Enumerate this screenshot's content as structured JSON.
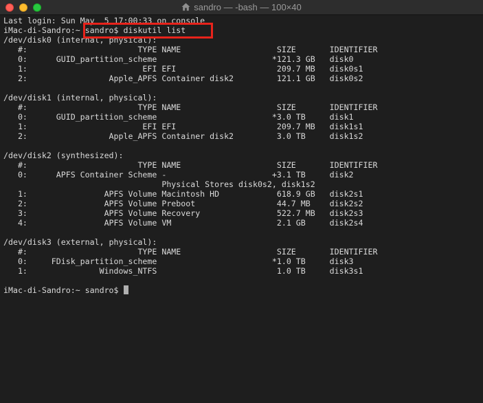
{
  "window": {
    "title": "sandro — -bash — 100×40"
  },
  "terminal": {
    "lines": [
      "Last login: Sun May  5 17:00:33 on console",
      "iMac-di-Sandro:~ sandro$ diskutil list",
      "/dev/disk0 (internal, physical):",
      "   #:                       TYPE NAME                    SIZE       IDENTIFIER",
      "   0:      GUID_partition_scheme                        *121.3 GB   disk0",
      "   1:                        EFI EFI                     209.7 MB   disk0s1",
      "   2:                 Apple_APFS Container disk2         121.1 GB   disk0s2",
      "",
      "/dev/disk1 (internal, physical):",
      "   #:                       TYPE NAME                    SIZE       IDENTIFIER",
      "   0:      GUID_partition_scheme                        *3.0 TB     disk1",
      "   1:                        EFI EFI                     209.7 MB   disk1s1",
      "   2:                 Apple_APFS Container disk2         3.0 TB     disk1s2",
      "",
      "/dev/disk2 (synthesized):",
      "   #:                       TYPE NAME                    SIZE       IDENTIFIER",
      "   0:      APFS Container Scheme -                      +3.1 TB     disk2",
      "                                 Physical Stores disk0s2, disk1s2",
      "   1:                APFS Volume Macintosh HD            618.9 GB   disk2s1",
      "   2:                APFS Volume Preboot                 44.7 MB    disk2s2",
      "   3:                APFS Volume Recovery                522.7 MB   disk2s3",
      "   4:                APFS Volume VM                      2.1 GB     disk2s4",
      "",
      "/dev/disk3 (external, physical):",
      "   #:                       TYPE NAME                    SIZE       IDENTIFIER",
      "   0:     FDisk_partition_scheme                        *1.0 TB     disk3",
      "   1:               Windows_NTFS                         1.0 TB     disk3s1",
      ""
    ],
    "prompt": "iMac-di-Sandro:~ sandro$ "
  },
  "colors": {
    "background": "#1e1e1e",
    "text": "#dadada",
    "highlight_box": "#e8231b"
  },
  "icons": {
    "title_icon": "home-folder-icon"
  }
}
